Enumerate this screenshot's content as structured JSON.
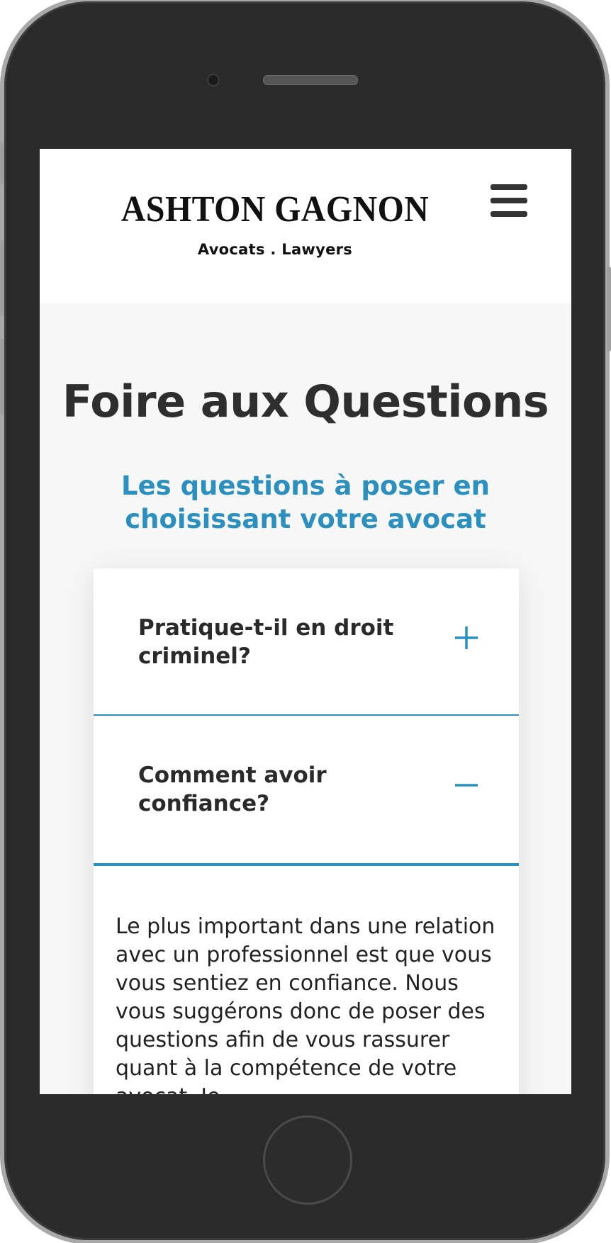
{
  "header": {
    "brand_name": "ASHTON GAGNON",
    "brand_tagline": "Avocats . Lawyers",
    "menu_icon": "hamburger-menu-icon"
  },
  "page": {
    "title": "Foire aux Questions",
    "subtitle": "Les questions à poser en choisissant votre avocat"
  },
  "faq": {
    "items": [
      {
        "question": "Pratique-t-il en droit criminel?",
        "icon": "plus-icon",
        "expanded": false
      },
      {
        "question": "Comment avoir confiance?",
        "icon": "minus-icon",
        "expanded": true
      }
    ],
    "answer": "Le plus important dans une relation avec un professionnel est que vous vous sentiez en confiance. Nous vous suggérons donc de poser des questions afin de vous rassurer quant à la compétence de votre avocat. Je"
  },
  "colors": {
    "accent": "#2b8fc0",
    "title": "#2e2e2e",
    "background": "#f7f7f7",
    "phone_body": "#2a2a2a"
  }
}
